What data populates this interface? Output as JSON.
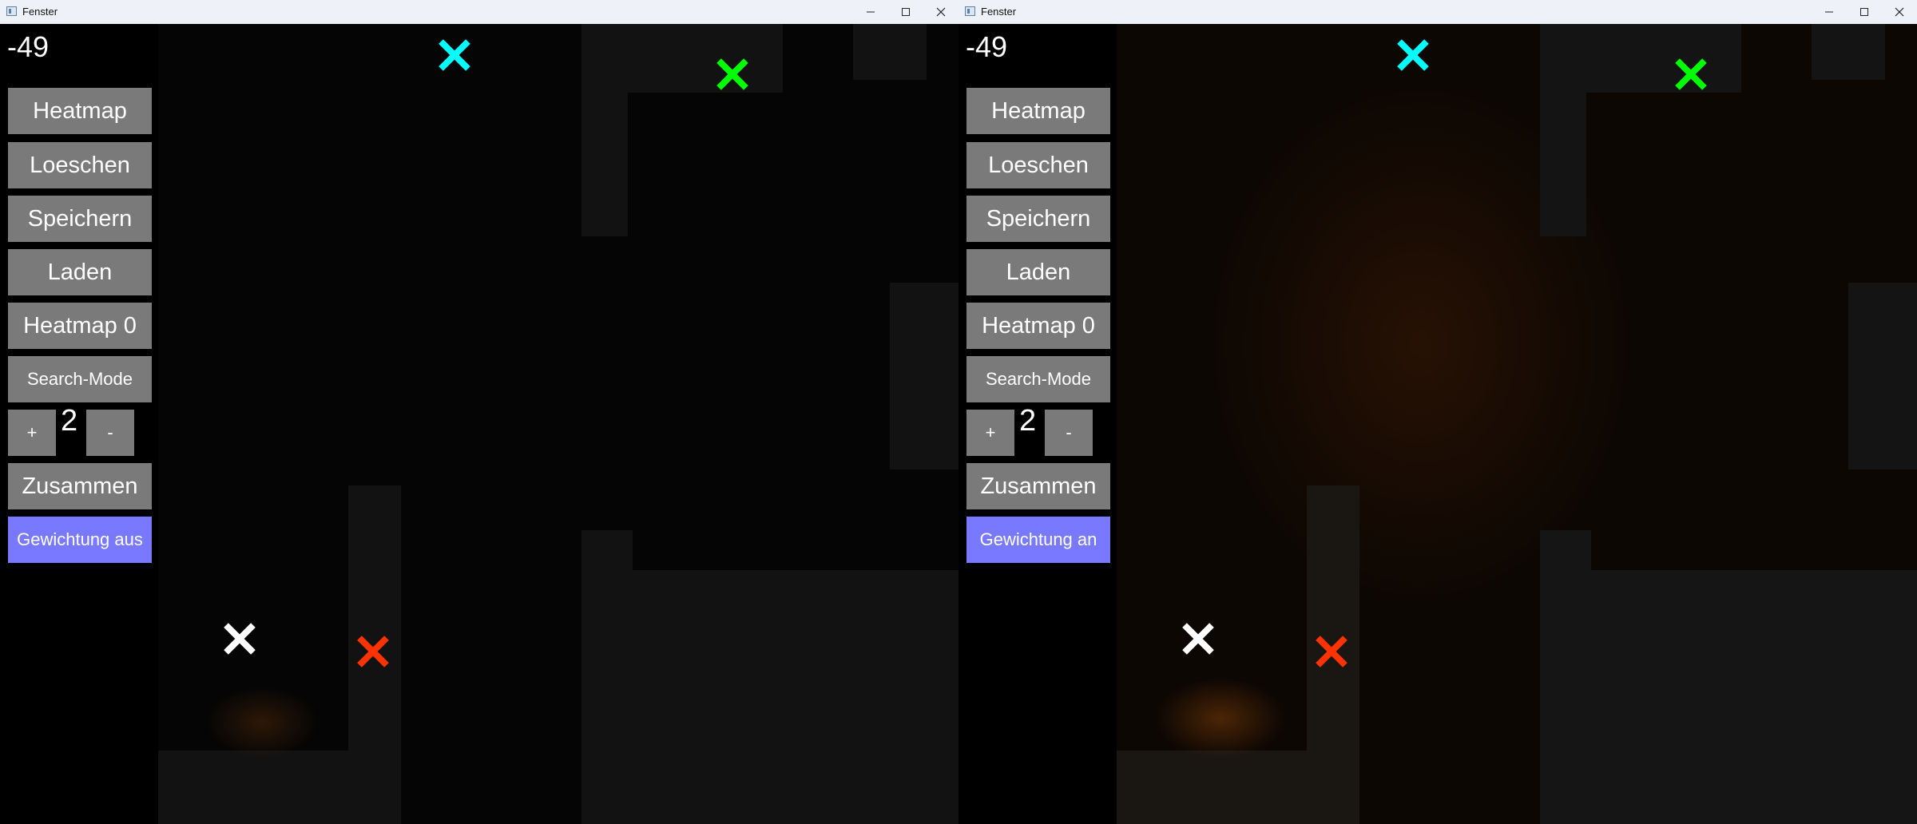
{
  "app": {
    "window_title": "Fenster"
  },
  "left": {
    "score": "-49",
    "buttons": {
      "heatmap": "Heatmap",
      "loeschen": "Loeschen",
      "speichern": "Speichern",
      "laden": "Laden",
      "heatmap_index": "Heatmap 0",
      "search_mode": "Search-Mode",
      "plus": "+",
      "minus": "-",
      "zusammen": "Zusammen",
      "gewichtung": "Gewichtung aus"
    },
    "counter": "2"
  },
  "right": {
    "score": "-49",
    "buttons": {
      "heatmap": "Heatmap",
      "loeschen": "Loeschen",
      "speichern": "Speichern",
      "laden": "Laden",
      "heatmap_index": "Heatmap 0",
      "search_mode": "Search-Mode",
      "plus": "+",
      "minus": "-",
      "zusammen": "Zusammen",
      "gewichtung": "Gewichtung an"
    },
    "counter": "2"
  },
  "colors": {
    "button_gray": "#7a7a7a",
    "toggle_blue": "#7979ff",
    "marker_cyan": "#00ffff",
    "marker_green": "#00ff00",
    "marker_white": "#ffffff",
    "marker_red": "#ff3300"
  },
  "icons": [
    "app-icon",
    "minimize-icon",
    "maximize-icon",
    "close-icon",
    "cross-marker"
  ]
}
